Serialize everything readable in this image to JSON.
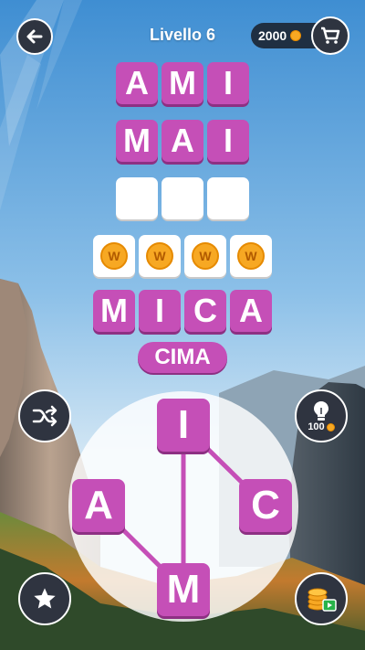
{
  "header": {
    "level_title": "Livello 6",
    "coins": "2000",
    "back_icon": "arrow-left-icon",
    "shop_icon": "cart-icon"
  },
  "board": {
    "words": [
      {
        "letters": [
          "A",
          "M",
          "I"
        ],
        "state": "solved"
      },
      {
        "letters": [
          "M",
          "A",
          "I"
        ],
        "state": "solved"
      },
      {
        "letters": [
          "",
          "",
          ""
        ],
        "state": "empty"
      },
      {
        "letters": [
          "W",
          "W",
          "W",
          "W"
        ],
        "state": "coin-bonus"
      },
      {
        "letters": [
          "M",
          "I",
          "C",
          "A"
        ],
        "state": "solved"
      }
    ]
  },
  "current_word": "CIMA",
  "wheel": {
    "letters": [
      "I",
      "A",
      "C",
      "M"
    ],
    "selection_order": [
      "C",
      "I",
      "M",
      "A"
    ]
  },
  "side_buttons": {
    "shuffle_icon": "shuffle-icon",
    "hint_icon": "lightbulb-icon",
    "hint_cost": "100",
    "favorites_icon": "star-icon",
    "video_coins_icon": "video-coins-icon"
  },
  "colors": {
    "tile": "#c54fb7",
    "button": "#2f3440",
    "coin": "#f7a823",
    "sky": "#5b9fd4"
  }
}
